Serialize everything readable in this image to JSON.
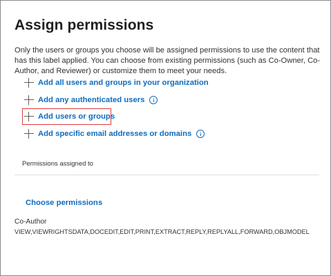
{
  "page": {
    "title": "Assign permissions",
    "description": "Only the users or groups you choose will be assigned permissions to use the content that has this label applied. You can choose from existing permissions (such as Co-Owner, Co-Author, and Reviewer) or customize them to meet your needs."
  },
  "actions": [
    {
      "label": "Add all users and groups in your organization",
      "info": false
    },
    {
      "label": "Add any authenticated users",
      "info": true
    },
    {
      "label": "Add users or groups",
      "info": false,
      "highlighted": true
    },
    {
      "label": "Add specific email addresses or domains",
      "info": true
    }
  ],
  "permissions": {
    "section_label": "Permissions assigned to",
    "choose_label": "Choose permissions",
    "role_name": "Co-Author",
    "rights": "VIEW,VIEWRIGHTSDATA,DOCEDIT,EDIT,PRINT,EXTRACT,REPLY,REPLYALL,FORWARD,OBJMODEL"
  },
  "colors": {
    "link": "#0f6cbd",
    "highlight_border": "#e03a3a",
    "text": "#323130"
  },
  "icons": {
    "add": "plus-icon",
    "info": "info-icon"
  }
}
